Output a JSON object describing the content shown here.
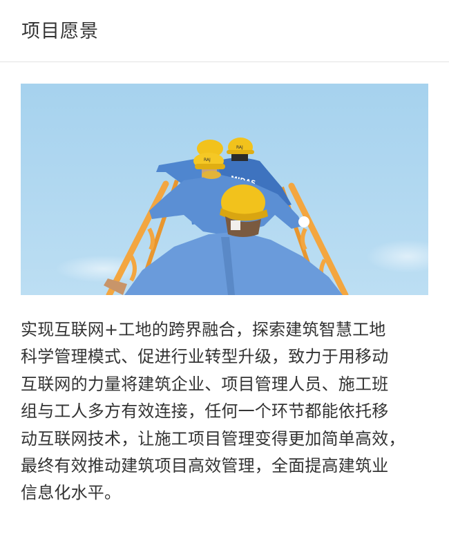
{
  "header": {
    "title": "项目愿景"
  },
  "hero": {
    "image_label": "Workers in hard hats climbing an orange ladder against a blue sky",
    "helmet_texts": [
      "RAJ",
      "RAJ",
      "MIDAS"
    ],
    "colors": {
      "sky": "#a9d4ef",
      "ladder": "#f3a640",
      "helmet": "#f2c21c",
      "uniform": "#4f86cf"
    }
  },
  "content": {
    "lines": [
      "实现互联网+工地的跨界融合，探索建筑智慧工地",
      "科学管理模式、促进行业转型升级，致力于用移动",
      "互联网的力量将建筑企业、项目管理人员、施工班",
      "组与工人多方有效连接，任何一个环节都能依托移",
      "动互联网技术，让施工项目管理变得更加简单高效，",
      "最终有效推动建筑项目高效管理，全面提高建筑业",
      "信息化水平。"
    ]
  }
}
